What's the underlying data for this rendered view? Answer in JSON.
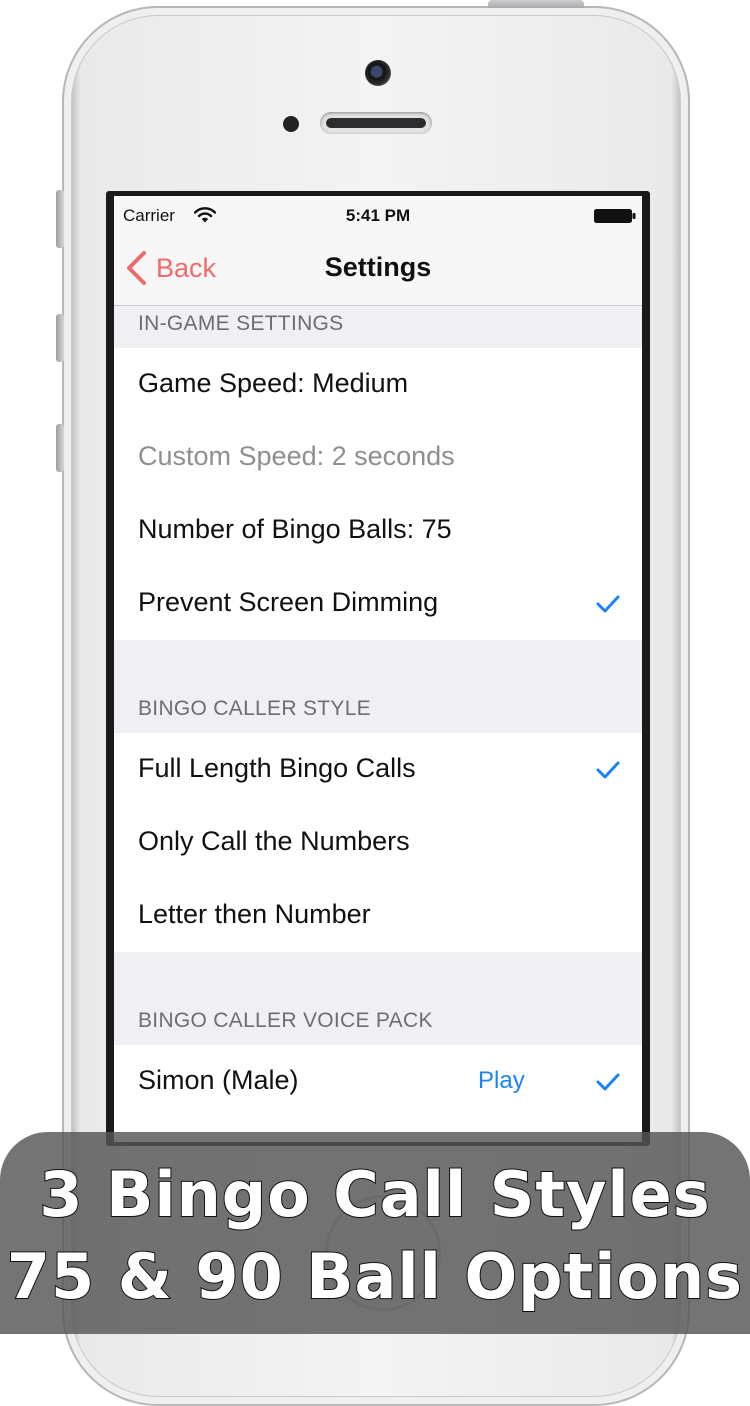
{
  "status_bar": {
    "carrier": "Carrier",
    "time": "5:41 PM"
  },
  "nav": {
    "back_label": "Back",
    "title": "Settings"
  },
  "colors": {
    "tint": "#ef6b6b",
    "check": "#1a84f5",
    "group_bg": "#efeff4"
  },
  "sections": [
    {
      "header": "IN-GAME SETTINGS",
      "rows": [
        {
          "label": "Game Speed: Medium",
          "checked": false,
          "disabled": false
        },
        {
          "label": "Custom Speed: 2 seconds",
          "checked": false,
          "disabled": true
        },
        {
          "label": "Number of Bingo Balls: 75",
          "checked": false,
          "disabled": false
        },
        {
          "label": "Prevent Screen Dimming",
          "checked": true,
          "disabled": false
        }
      ]
    },
    {
      "header": "BINGO CALLER STYLE",
      "rows": [
        {
          "label": "Full Length Bingo Calls",
          "checked": true
        },
        {
          "label": "Only Call the Numbers",
          "checked": false
        },
        {
          "label": "Letter then Number",
          "checked": false
        }
      ]
    },
    {
      "header": "BINGO CALLER VOICE PACK",
      "rows": [
        {
          "label": "Simon (Male)",
          "action": "Play",
          "checked": true
        }
      ]
    }
  ],
  "banner": {
    "line1": "3 Bingo Call Styles",
    "line2": "75 & 90 Ball Options"
  }
}
